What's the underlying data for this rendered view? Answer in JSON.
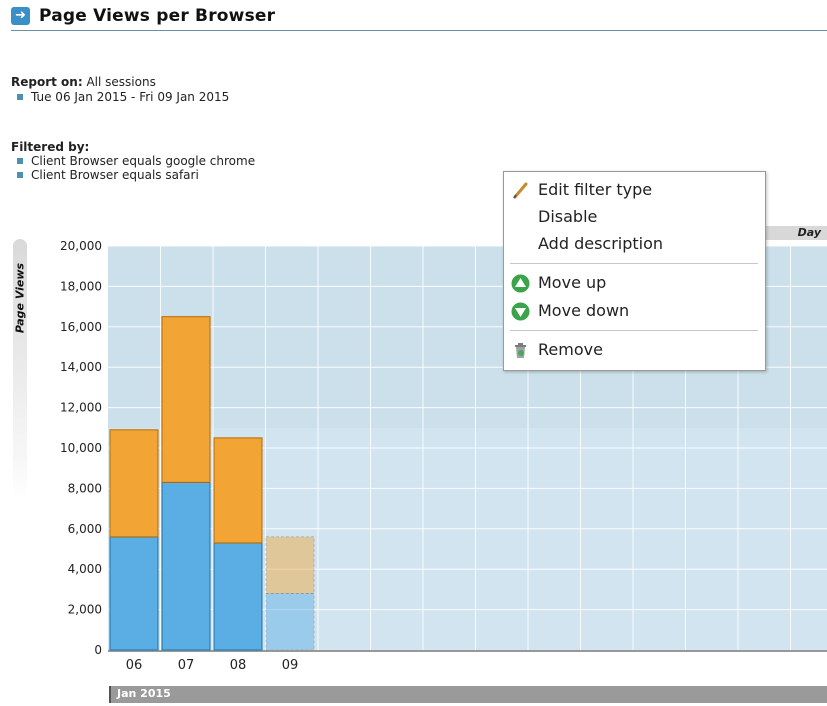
{
  "report": {
    "title": "Page Views per Browser",
    "report_on_label": "Report on:",
    "report_on_value": "All sessions",
    "date_range": "Tue 06 Jan 2015 - Fri 09 Jan 2015",
    "filtered_by_label": "Filtered by:",
    "filters": [
      "Client Browser equals google chrome",
      "Client Browser equals safari"
    ]
  },
  "context_menu": {
    "items": {
      "edit": "Edit filter type",
      "disable": "Disable",
      "add_description": "Add description",
      "move_up": "Move up",
      "move_down": "Move down",
      "remove": "Remove"
    }
  },
  "chart_data": {
    "type": "bar",
    "stacked": true,
    "ylabel": "Page Views",
    "period_label": "Day",
    "month_label": "Jan 2015",
    "categories": [
      "06",
      "07",
      "08",
      "09"
    ],
    "ylim": [
      0,
      20000
    ],
    "yticks": [
      "0",
      "2,000",
      "4,000",
      "6,000",
      "8,000",
      "10,000",
      "12,000",
      "14,000",
      "16,000",
      "18,000",
      "20,000"
    ],
    "series": [
      {
        "values": [
          5600,
          8300,
          5300,
          2800
        ],
        "color": "#5aaee4"
      },
      {
        "values": [
          5300,
          8200,
          5200,
          2800
        ],
        "color": "#f2a534"
      }
    ],
    "partial_category": "09",
    "grid": true,
    "plot_background": "#d2e4ef"
  }
}
